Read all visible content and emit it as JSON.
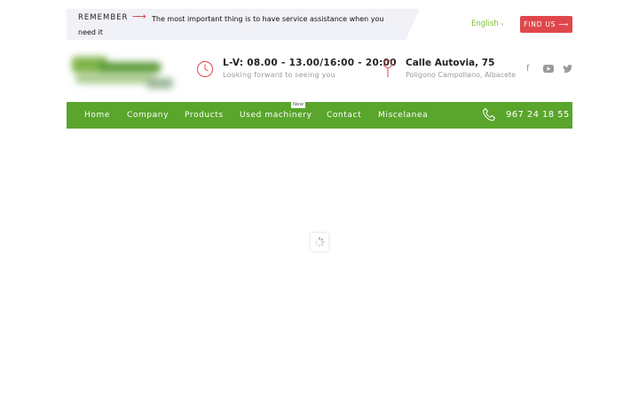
{
  "topbar": {
    "remember_label": "REMEMBER",
    "remember_arrow": "⟶",
    "remember_text": "The most important thing is to have service assistance when you need it",
    "language": "English",
    "find_us": "FIND US"
  },
  "header": {
    "hours": "L-V: 08.00 - 13.00/16:00 - 20:00",
    "hours_sub": "Looking forward to seeing you",
    "address": "Calle Autovia, 75",
    "address_sub": "Poligono Campollano, Albacete",
    "social": [
      "facebook-icon",
      "youtube-icon",
      "twitter-icon"
    ]
  },
  "nav": {
    "items": [
      "Home",
      "Company",
      "Products",
      "Used machinery",
      "Contact",
      "Miscelanea"
    ],
    "badge": "New",
    "phone": "967 24 18 55"
  },
  "colors": {
    "accent_green": "#5aa52c",
    "light_green": "#7cbf2e",
    "red": "#e0474c"
  }
}
